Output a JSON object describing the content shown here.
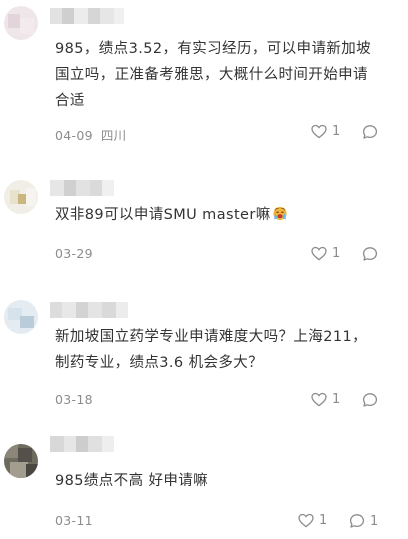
{
  "comments": [
    {
      "text_lines": [
        "985，绩点3.52，有实习经历，可以申请新加坡",
        "国立吗，正准备考雅思，大概什么时间开始申请",
        "合适"
      ],
      "date": "04-09",
      "location": "四川",
      "likes": "1",
      "replies": ""
    },
    {
      "text_lines": [
        "双非89可以申请SMU master嘛"
      ],
      "emoji": "crying-face-emoji",
      "date": "03-29",
      "location": "",
      "likes": "1",
      "replies": ""
    },
    {
      "text_lines": [
        "新加坡国立药学专业申请难度大吗？上海211，",
        "制药专业，绩点3.6 机会多大？"
      ],
      "date": "03-18",
      "location": "",
      "likes": "1",
      "replies": ""
    },
    {
      "text_lines": [
        "985绩点不高 好申请嘛"
      ],
      "date": "03-11",
      "location": "",
      "likes": "1",
      "replies": "1"
    }
  ],
  "icons": {
    "like": "heart-outline-icon",
    "reply": "speech-bubble-icon"
  },
  "colors": {
    "text": "#333333",
    "meta": "#8c8c8c"
  }
}
